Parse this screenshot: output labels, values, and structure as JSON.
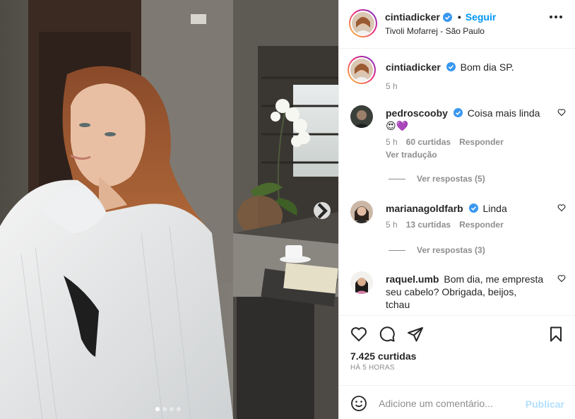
{
  "post": {
    "username": "cintiadicker",
    "follow_label": "Seguir",
    "separator": "•",
    "location": "Tivoli Mofarrej - São Paulo",
    "caption": "Bom dia SP.",
    "caption_time": "5 h",
    "likes": "7.425 curtidas",
    "time_ago": "HÁ 5 HORAS",
    "carousel": {
      "total_slides": 4,
      "active_slide": 1
    }
  },
  "comments": [
    {
      "username": "pedroscooby",
      "verified": true,
      "text": "Coisa mais linda",
      "emoji": "😍💜",
      "time": "5 h",
      "likes": "60 curtidas",
      "reply_label": "Responder",
      "translate_label": "Ver tradução",
      "replies_label": "Ver respostas (5)"
    },
    {
      "username": "marianagoldfarb",
      "verified": true,
      "text": "Linda",
      "time": "5 h",
      "likes": "13 curtidas",
      "reply_label": "Responder",
      "replies_label": "Ver respostas (3)"
    },
    {
      "username": "raquel.umb",
      "verified": false,
      "text_line1": "Bom dia, me empresta",
      "text_line2": "seu cabelo? Obrigada, beijos,",
      "text_line3": "tchau"
    }
  ],
  "composer": {
    "placeholder": "Adicione um comentário...",
    "publish_label": "Publicar"
  },
  "icons": {
    "verified": "verified-badge-icon",
    "more": "more-options-icon",
    "like": "heart-icon",
    "comment": "comment-icon",
    "share": "share-icon",
    "save": "bookmark-icon",
    "emoji": "emoji-icon",
    "next": "chevron-right-icon"
  },
  "colors": {
    "accent": "#0095f6",
    "verified": "#3897f0",
    "muted": "#8e8e8e",
    "publish_disabled": "#b2dffc"
  }
}
